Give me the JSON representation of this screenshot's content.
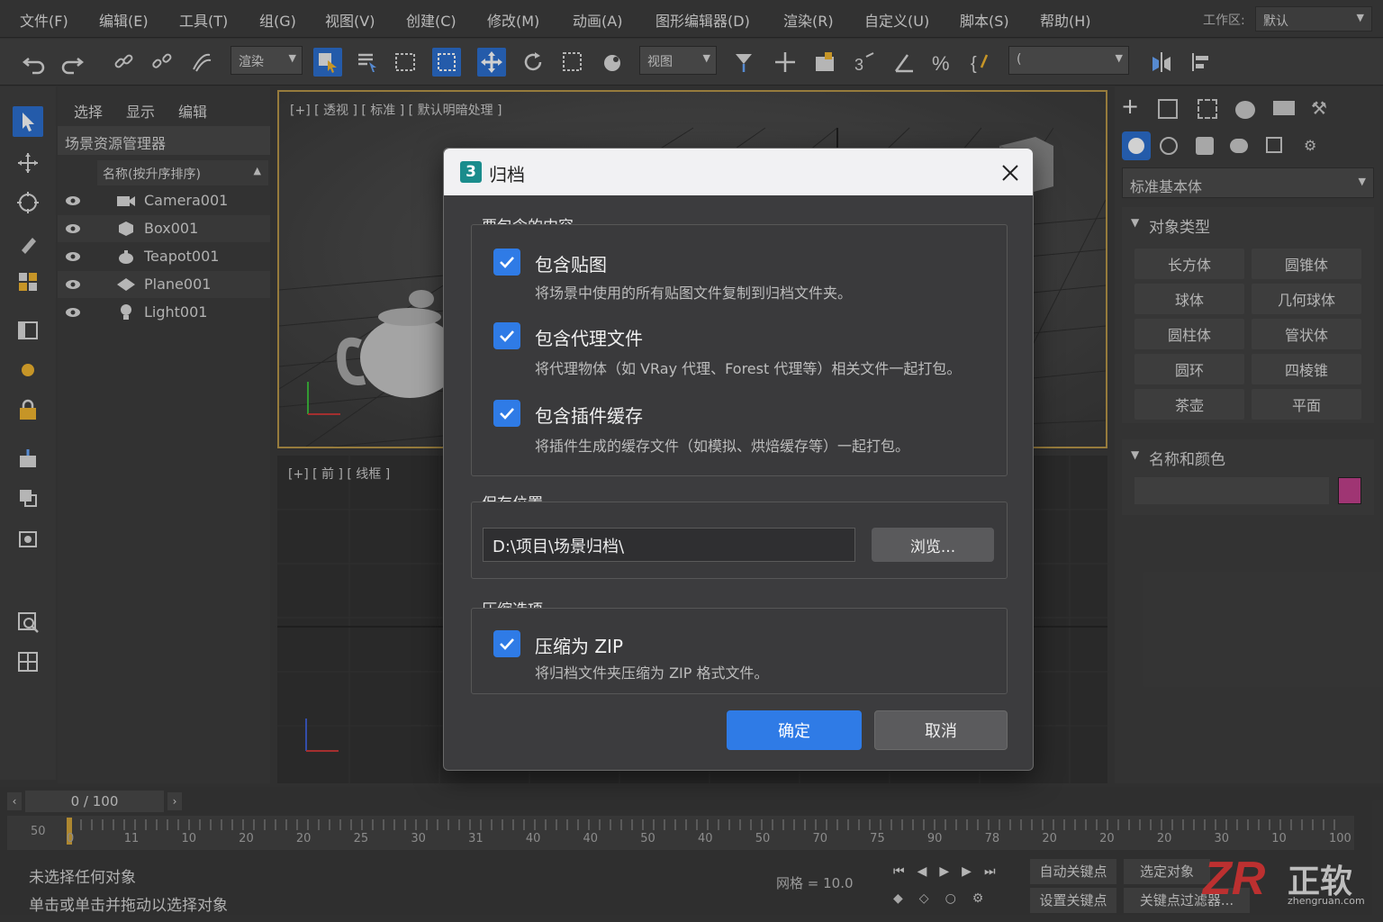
{
  "menubar": {
    "items": [
      "文件(F)",
      "编辑(E)",
      "工具(T)",
      "组(G)",
      "视图(V)",
      "创建(C)",
      "修改(M)",
      "动画(A)",
      "图形编辑器(D)",
      "渲染(R)",
      "自定义(U)",
      "脚本(S)",
      "帮助(H)"
    ],
    "workspace_label": "工作区:",
    "workspace_value": "默认"
  },
  "toolbar": {
    "filter_select": "渲染",
    "coord_select": "视图",
    "named_sel": "("
  },
  "scene": {
    "tabs": [
      "选择",
      "显示",
      "编辑"
    ],
    "title": "场景资源管理器",
    "column_header": "名称(按升序排序)",
    "items": [
      "Camera001",
      "Box001",
      "Teapot001",
      "Plane001",
      "Light001"
    ]
  },
  "viewports": {
    "top_label": "[+] [ 透视 ] [ 标准 ] [ 默认明暗处理 ]",
    "front_label": "[+] [ 前 ] [ 线框 ]"
  },
  "right_panel": {
    "dropdown": "标准基本体",
    "section1": "对象类型",
    "buttons": [
      "长方体",
      "圆锥体",
      "球体",
      "几何球体",
      "圆柱体",
      "管状体",
      "圆环",
      "四棱锥",
      "茶壶",
      "平面"
    ],
    "section2": "名称和颜色",
    "swatch_color": "#c2418d"
  },
  "timeline": {
    "counter": "0 / 100",
    "ticks": [
      "0",
      "11",
      "10",
      "20",
      "20",
      "25",
      "30",
      "31",
      "40",
      "40",
      "50",
      "40",
      "50",
      "70",
      "75",
      "90",
      "78",
      "20",
      "20",
      "20",
      "30",
      "10",
      "100"
    ],
    "start_marker": "50"
  },
  "status": {
    "line1": "未选择任何对象",
    "line2": "单击或单击并拖动以选择对象",
    "grid": "网格 = 10.0",
    "auto_key": "自动关键点",
    "selected_obj": "选定对象",
    "set_key": "设置关键点",
    "key_filter": "关键点过滤器..."
  },
  "watermark": {
    "brand": "ZR",
    "cn": "正软",
    "url": "zhengruan.com"
  },
  "dialog": {
    "app_icon": "3",
    "title": "归档",
    "section_content": "要包含的内容",
    "opt1_label": "包含贴图",
    "opt1_desc": "将场景中使用的所有贴图文件复制到归档文件夹。",
    "opt2_label": "包含代理文件",
    "opt2_desc": "将代理物体（如 VRay 代理、Forest 代理等）相关文件一起打包。",
    "opt3_label": "包含插件缓存",
    "opt3_desc": "将插件生成的缓存文件（如模拟、烘焙缓存等）一起打包。",
    "section_location": "保存位置",
    "path_value": "D:\\项目\\场景归档\\",
    "browse": "浏览...",
    "section_compress": "压缩选项",
    "opt4_label": "压缩为 ZIP",
    "opt4_desc": "将归档文件夹压缩为 ZIP 格式文件。",
    "ok": "确定",
    "cancel": "取消",
    "accent": "#2f7be6"
  }
}
